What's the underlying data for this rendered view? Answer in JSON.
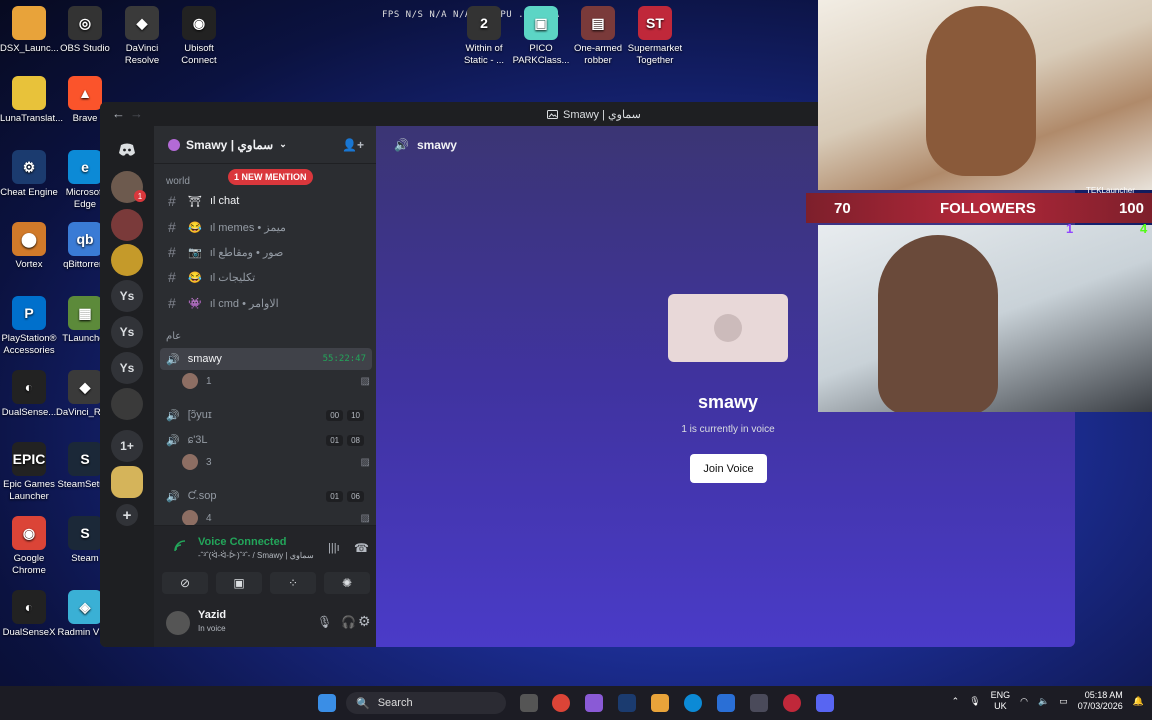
{
  "desktop": {
    "overlay_text": "FPS N/S N/A N/A... GPU ... N/A",
    "icons": [
      {
        "label": "DSX_Launc...",
        "color": "#e8a33a",
        "glyph": ""
      },
      {
        "label": "OBS Studio",
        "color": "#333",
        "glyph": "◎"
      },
      {
        "label": "DaVinci Resolve",
        "color": "#3a3a3a",
        "glyph": "◆"
      },
      {
        "label": "Ubisoft Connect",
        "color": "#222",
        "glyph": "◉"
      },
      {
        "label": "LunaTranslat...",
        "color": "#e8c23a",
        "glyph": ""
      },
      {
        "label": "Brave",
        "color": "#fb542b",
        "glyph": "▲"
      },
      {
        "label": "Cheat Engine",
        "color": "#1b3b6f",
        "glyph": "⚙"
      },
      {
        "label": "Microsoft Edge",
        "color": "#0c8ad6",
        "glyph": "e"
      },
      {
        "label": "Vortex",
        "color": "#d17a2a",
        "glyph": "⬤"
      },
      {
        "label": "qBittorrent",
        "color": "#3a7bd5",
        "glyph": "qb"
      },
      {
        "label": "PlayStation® Accessories",
        "color": "#0070cc",
        "glyph": "P"
      },
      {
        "label": "TLauncher",
        "color": "#5c8a3a",
        "glyph": "▦"
      },
      {
        "label": "DualSense...",
        "color": "#222",
        "glyph": "◐"
      },
      {
        "label": "DaVinci_Re...",
        "color": "#3a3a3a",
        "glyph": "◆"
      },
      {
        "label": "Epic Games Launcher",
        "color": "#222",
        "glyph": "EPIC"
      },
      {
        "label": "SteamSetu...",
        "color": "#1b2838",
        "glyph": "S"
      },
      {
        "label": "Google Chrome",
        "color": "#db4437",
        "glyph": "◉"
      },
      {
        "label": "Steam",
        "color": "#1b2838",
        "glyph": "S"
      },
      {
        "label": "DualSenseX",
        "color": "#222",
        "glyph": "◐"
      },
      {
        "label": "Radmin VPN",
        "color": "#3ab0d5",
        "glyph": "◈"
      },
      {
        "label": "Within of Static - ...",
        "color": "#333",
        "glyph": "2"
      },
      {
        "label": "PICO PARKClass...",
        "color": "#5cd5c5",
        "glyph": "▣"
      },
      {
        "label": "One-armed robber",
        "color": "#7a3a3a",
        "glyph": "▤"
      },
      {
        "label": "Supermarket Together",
        "color": "#c0283a",
        "glyph": "ST"
      }
    ]
  },
  "window": {
    "title": "Smawy | سماوي",
    "back": "←",
    "forward": "→"
  },
  "guilds": {
    "items": [
      {
        "label": "",
        "kind": "discord-home"
      },
      {
        "label": "",
        "kind": "avatar"
      },
      {
        "label": "",
        "kind": "avatar"
      },
      {
        "label": "",
        "kind": "avatar"
      },
      {
        "label": "Ys",
        "kind": "text"
      },
      {
        "label": "Ys",
        "kind": "text"
      },
      {
        "label": "Ys",
        "kind": "text"
      },
      {
        "label": "",
        "kind": "image"
      },
      {
        "label": "1+",
        "kind": "text"
      },
      {
        "label": "",
        "kind": "image"
      },
      {
        "label": "+",
        "kind": "add"
      }
    ],
    "badge": "1"
  },
  "server": {
    "name": "Smawy | سماوي",
    "category1": "world",
    "mention": "1 NEW MENTION",
    "channels": [
      {
        "label": "ıl chat",
        "emoji": "⛩",
        "active": true
      },
      {
        "label": "ıl memes • ميمز",
        "emoji": "😂",
        "active": false
      },
      {
        "label": "ıl صور • ومقاطع",
        "emoji": "📷",
        "active": false
      },
      {
        "label": "ıl تكليجات",
        "emoji": "😂",
        "active": false
      },
      {
        "label": "ıl cmd • الاوامر",
        "emoji": "👾",
        "active": false
      }
    ],
    "category2": "عام",
    "voice": [
      {
        "label": "smawy",
        "timer": "55:22:47",
        "cnt": [],
        "selected": true
      },
      {
        "label": "[ɔ̃yuɪ",
        "timer": "",
        "cnt": [
          "00",
          "10"
        ],
        "selected": false
      },
      {
        "label": "ɕ'3L",
        "timer": "",
        "cnt": [
          "01",
          "08"
        ],
        "selected": false
      },
      {
        "label": "Ƈ.sop",
        "timer": "",
        "cnt": [
          "01",
          "06"
        ],
        "selected": false
      }
    ],
    "users": [
      {
        "label": "1"
      },
      {
        "label": "3"
      },
      {
        "label": "4"
      }
    ]
  },
  "voice_panel": {
    "status": "Voice Connected",
    "sub": "-ˆ³ˆ(ᐛ-ᐛ-ᐕ)ˆ³ˆ- / Smawy | سماوي"
  },
  "userbar": {
    "name": "Yazid",
    "status": "In voice"
  },
  "main": {
    "channel": "smawy",
    "title": "smawy",
    "subtitle": "1 is currently in voice",
    "join": "Join Voice"
  },
  "webcam": {
    "followers_count": "70",
    "followers_label": "FOLLOWERS",
    "followers_goal": "100",
    "launcher": "TEKLauncher",
    "twitch": "1",
    "kick": "4"
  },
  "taskbar": {
    "search": "Search",
    "lang1": "ENG",
    "lang2": "UK",
    "time": "05:18 AM",
    "date": "07/03/2026"
  }
}
